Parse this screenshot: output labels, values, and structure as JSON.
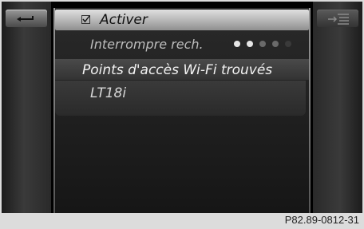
{
  "colors": {
    "display_bg": "#000000",
    "selected_row": "#bdbdbd",
    "dot_active": "#e6e6e6",
    "dot_inactive": "#6a6a6a"
  },
  "back_button": {
    "icon": "back-arrow-icon"
  },
  "menu_button": {
    "icon": "list-menu-icon"
  },
  "list": {
    "activer": {
      "label": "Activer",
      "icon": "checkbox-icon",
      "checked": true
    },
    "interrompre": {
      "label": "Interrompre rech.",
      "progress": {
        "total": 5,
        "active": 2
      }
    },
    "points_header": {
      "label": "Points d'accès Wi-Fi trouvés"
    },
    "network": {
      "label": "LT18i"
    }
  },
  "footer": {
    "code": "P82.89-0812-31"
  }
}
